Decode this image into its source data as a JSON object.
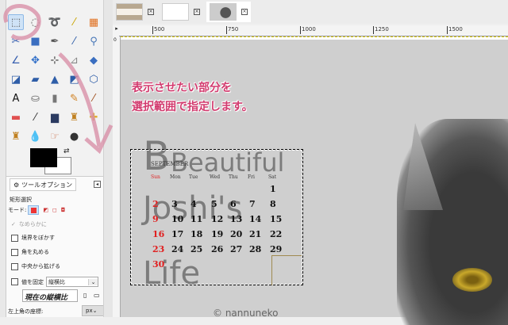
{
  "image_tabs": [
    {
      "name": "image-tab-1"
    },
    {
      "name": "image-tab-2"
    },
    {
      "name": "image-tab-3",
      "active": true
    }
  ],
  "ruler": {
    "h_labels": [
      "500",
      "750",
      "1000",
      "1250",
      "1500"
    ],
    "v_labels": [
      "0",
      "500",
      "750"
    ]
  },
  "tools": [
    {
      "icon": "rect-select-icon",
      "g": "⬚",
      "c": "#555"
    },
    {
      "icon": "ellipse-select-icon",
      "g": "◌",
      "c": "#555"
    },
    {
      "icon": "lasso-icon",
      "g": "➰",
      "c": "#666"
    },
    {
      "icon": "fuzzy-select-icon",
      "g": "⁄",
      "c": "#c9a400"
    },
    {
      "icon": "color-select-icon",
      "g": "▦",
      "c": "#e07020"
    },
    {
      "icon": "scissors-icon",
      "g": "✂",
      "c": "#3860b0"
    },
    {
      "icon": "foreground-select-icon",
      "g": "■",
      "c": "#3a6ec0"
    },
    {
      "icon": "paths-icon",
      "g": "✒",
      "c": "#555"
    },
    {
      "icon": "color-picker-icon",
      "g": "⁄",
      "c": "#2f5ea8"
    },
    {
      "icon": "zoom-icon",
      "g": "⚲",
      "c": "#4a78b8"
    },
    {
      "icon": "measure-icon",
      "g": "∠",
      "c": "#3860b0"
    },
    {
      "icon": "move-icon",
      "g": "✥",
      "c": "#2f6ec8"
    },
    {
      "icon": "align-icon",
      "g": "⊹",
      "c": "#333"
    },
    {
      "icon": "crop-icon",
      "g": "⊿",
      "c": "#888"
    },
    {
      "icon": "rotate-icon",
      "g": "◆",
      "c": "#3a6ec0"
    },
    {
      "icon": "scale-icon",
      "g": "◪",
      "c": "#2f5ea8"
    },
    {
      "icon": "shear-icon",
      "g": "▰",
      "c": "#2f5ea8"
    },
    {
      "icon": "perspective-icon",
      "g": "▲",
      "c": "#2f5ea8"
    },
    {
      "icon": "flip-icon",
      "g": "◩",
      "c": "#2f5ea8"
    },
    {
      "icon": "cage-icon",
      "g": "⬡",
      "c": "#2f5ea8"
    },
    {
      "icon": "text-icon",
      "g": "A",
      "c": "#111"
    },
    {
      "icon": "bucket-fill-icon",
      "g": "⛀",
      "c": "#666"
    },
    {
      "icon": "gradient-icon",
      "g": "▮",
      "c": "#777"
    },
    {
      "icon": "pencil-icon",
      "g": "✎",
      "c": "#d08020"
    },
    {
      "icon": "paintbrush-icon",
      "g": "⁄",
      "c": "#a05020"
    },
    {
      "icon": "eraser-icon",
      "g": "▬",
      "c": "#e05050"
    },
    {
      "icon": "airbrush-icon",
      "g": "⁄",
      "c": "#333"
    },
    {
      "icon": "ink-icon",
      "g": "▆",
      "c": "#2a3a60"
    },
    {
      "icon": "clone-icon",
      "g": "♜",
      "c": "#c08020"
    },
    {
      "icon": "heal-icon",
      "g": "✚",
      "c": "#e0b030"
    },
    {
      "icon": "perspective-clone-icon",
      "g": "♜",
      "c": "#c08020"
    },
    {
      "icon": "blur-icon",
      "g": "💧",
      "c": "#5a8ad0"
    },
    {
      "icon": "smudge-icon",
      "g": "☞",
      "c": "#d08060"
    },
    {
      "icon": "dodge-burn-icon",
      "g": "●",
      "c": "#333"
    }
  ],
  "tool_options": {
    "tab_label": "ツールオプション",
    "tool_name": "矩形選択",
    "mode_label": "モード:",
    "antialias": "なめらかに",
    "feather": "境界をぼかす",
    "round": "角を丸める",
    "expand_center": "中央から拡げる",
    "fixed": "値を固定",
    "fixed_select": "縦横比",
    "ratio_value": "現在の縦横比",
    "position_label": "左上角の座標:",
    "unit": "px"
  },
  "annotation": {
    "line1": "表示させたい部分を",
    "line2": "選択範囲で指定します。",
    "color": "#d23a6e"
  },
  "artwork": {
    "word1": "Beautiful",
    "word2": "Joshi's",
    "word3": "Life",
    "month": "SEPTEMBER",
    "days": [
      "Sun",
      "Mon",
      "Tue",
      "Wed",
      "Thu",
      "Fri",
      "Sat"
    ],
    "weeks": [
      [
        "",
        "",
        "",
        "",
        "",
        "",
        "1"
      ],
      [
        "2",
        "3",
        "4",
        "5",
        "6",
        "7",
        "8"
      ],
      [
        "9",
        "10",
        "11",
        "12",
        "13",
        "14",
        "15"
      ],
      [
        "16",
        "17",
        "18",
        "19",
        "20",
        "21",
        "22"
      ],
      [
        "23",
        "24",
        "25",
        "26",
        "27",
        "28",
        "29"
      ],
      [
        "30",
        "",
        "",
        "",
        "",
        "",
        ""
      ]
    ],
    "credit": "© nannuneko"
  }
}
